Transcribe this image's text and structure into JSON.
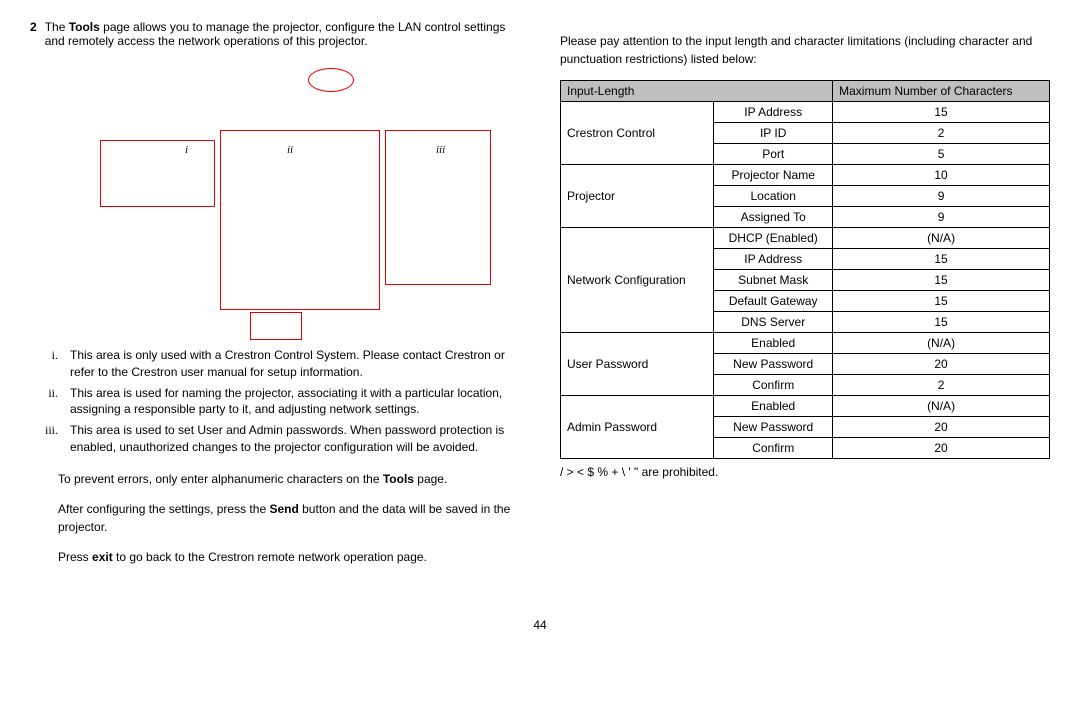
{
  "left": {
    "step": "2",
    "intro_a": "The ",
    "intro_tools": "Tools",
    "intro_b": " page allows you to manage the projector, configure the LAN control settings and remotely access the network operations of this projector.",
    "labels": {
      "i": "i",
      "ii": "ii",
      "iii": "iii"
    },
    "notes": [
      {
        "rn": "i.",
        "text": "This area is only used with a Crestron Control System. Please contact Crestron or refer to the Crestron user manual for setup information."
      },
      {
        "rn": "ii.",
        "text": "This area is used for naming the projector, associating it with a particular location, assigning a responsible party to it, and adjusting network settings."
      },
      {
        "rn": "iii.",
        "text": "This area is used to set User and Admin passwords. When password protection is enabled, unauthorized changes to the projector configuration will be avoided."
      }
    ],
    "p1_a": "To prevent errors, only enter alphanumeric characters on the ",
    "p1_tools": "Tools",
    "p1_b": " page.",
    "p2_a": "After configuring the settings, press the ",
    "p2_send": "Send",
    "p2_b": " button and the data will be saved in the projector.",
    "p3_a": "Press ",
    "p3_exit": "exit",
    "p3_b": " to go back to the Crestron remote network operation page."
  },
  "right": {
    "lead": "Please pay attention to the input length and character limitations (including character and punctuation restrictions) listed below:",
    "headers": {
      "col1": "Input-Length",
      "col2": "Maximum Number of Characters"
    },
    "groups": [
      {
        "name": "Crestron Control",
        "rows": [
          {
            "field": "IP Address",
            "max": "15"
          },
          {
            "field": "IP ID",
            "max": "2"
          },
          {
            "field": "Port",
            "max": "5"
          }
        ]
      },
      {
        "name": "Projector",
        "rows": [
          {
            "field": "Projector Name",
            "max": "10"
          },
          {
            "field": "Location",
            "max": "9"
          },
          {
            "field": "Assigned To",
            "max": "9"
          }
        ]
      },
      {
        "name": "Network Configuration",
        "rows": [
          {
            "field": "DHCP (Enabled)",
            "max": "(N/A)"
          },
          {
            "field": "IP Address",
            "max": "15"
          },
          {
            "field": "Subnet Mask",
            "max": "15"
          },
          {
            "field": "Default Gateway",
            "max": "15"
          },
          {
            "field": "DNS Server",
            "max": "15"
          }
        ]
      },
      {
        "name": "User Password",
        "rows": [
          {
            "field": "Enabled",
            "max": "(N/A)"
          },
          {
            "field": "New Password",
            "max": "20"
          },
          {
            "field": "Confirm",
            "max": "2"
          }
        ]
      },
      {
        "name": "Admin Password",
        "rows": [
          {
            "field": "Enabled",
            "max": "(N/A)"
          },
          {
            "field": "New Password",
            "max": "20"
          },
          {
            "field": "Confirm",
            "max": "20"
          }
        ]
      }
    ],
    "footnote": "/ > < $ % + \\ ' \" are prohibited."
  },
  "page_number": "44"
}
